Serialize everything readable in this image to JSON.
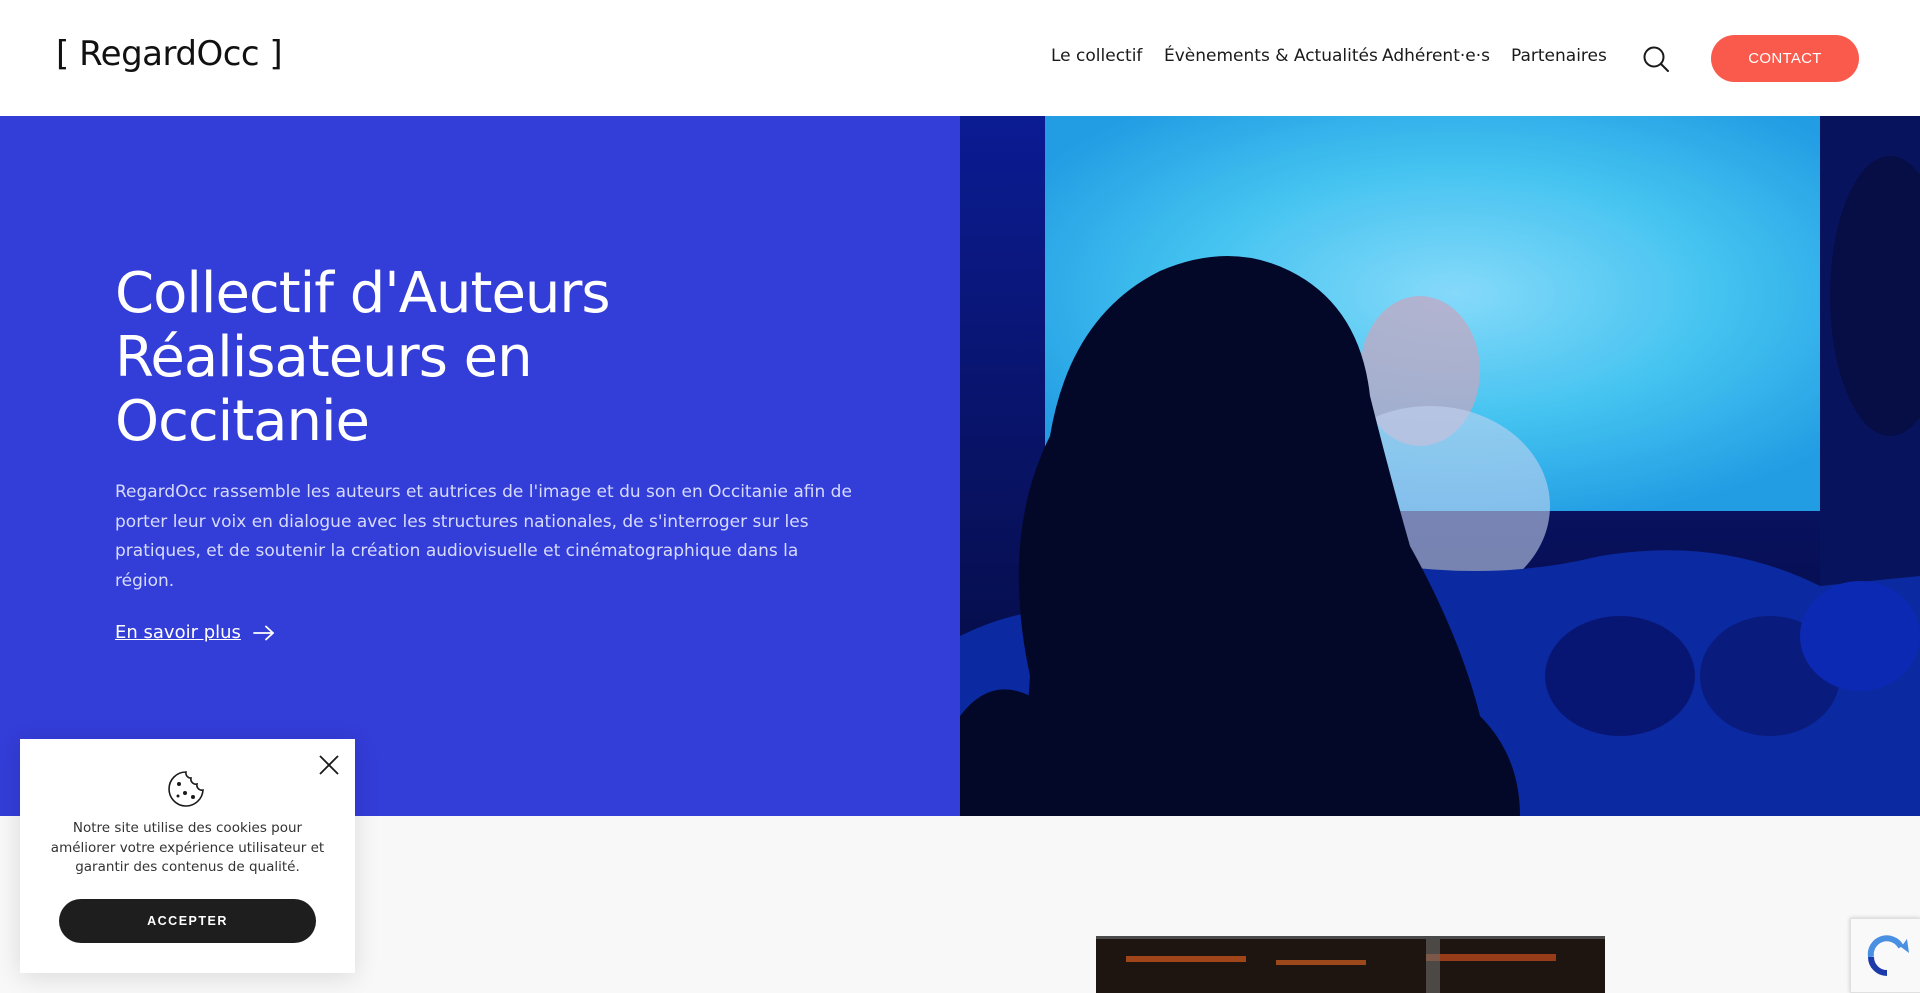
{
  "header": {
    "logo": "[ RegardOcc ]",
    "nav": [
      {
        "label": "Le collectif"
      },
      {
        "label": "Évènements & Actualités"
      },
      {
        "label": "Adhérent·e·s"
      },
      {
        "label": "Partenaires"
      }
    ],
    "contact_label": "CONTACT"
  },
  "hero": {
    "title": "Collectif d'Auteurs Réalisateurs en Occitanie",
    "description": "RegardOcc rassemble les auteurs et autrices de l'image et du son en Occitanie afin de porter leur voix en dialogue avec les structures nationales, de s'interroger sur les pratiques, et de soutenir la création audiovisuelle et cinématographique dans la région.",
    "link_label": "En savoir plus"
  },
  "cookie": {
    "text": "Notre site utilise des cookies pour améliorer votre expérience utilisateur et garantir des contenus de qualité.",
    "accept_label": "ACCEPTER"
  },
  "colors": {
    "hero_blue": "#333dd8",
    "contact_coral": "#fa5a4b",
    "cookie_button": "#1e1e1e"
  },
  "icons": [
    "search-icon",
    "arrow-right-icon",
    "close-icon",
    "cookie-icon",
    "recaptcha-icon"
  ]
}
